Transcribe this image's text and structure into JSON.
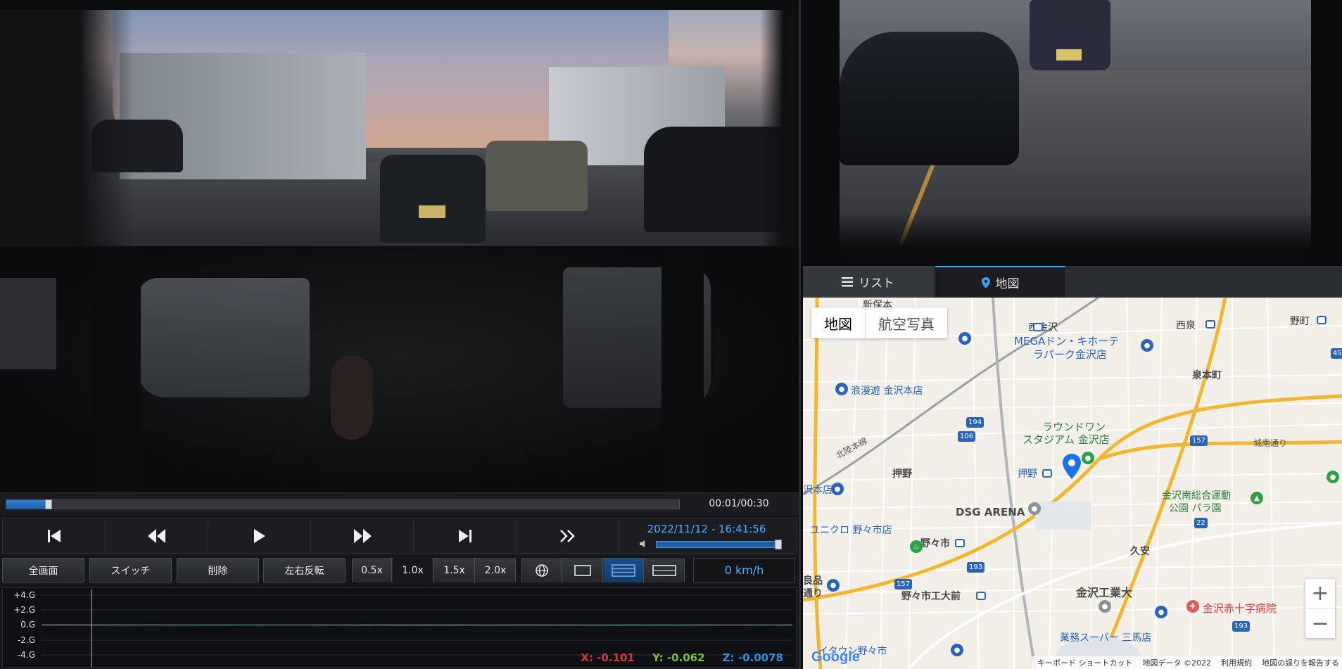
{
  "player": {
    "time_readout": "00:01/00:30",
    "progress": 0.063,
    "datetime": "2022/11/12 - 16:41:56",
    "volume": 1.0,
    "speed_readout": "0 km/h"
  },
  "transport": {
    "buttons": [
      {
        "name": "skip-to-start-icon"
      },
      {
        "name": "rewind-icon"
      },
      {
        "name": "play-icon"
      },
      {
        "name": "fast-forward-icon"
      },
      {
        "name": "skip-to-end-icon"
      },
      {
        "name": "double-chevron-right-icon"
      }
    ]
  },
  "controls": {
    "fullscreen": "全画面",
    "switch": "スイッチ",
    "delete": "削除",
    "mirror": "左右反転",
    "speeds": [
      "0.5x",
      "1.0x",
      "1.5x",
      "2.0x"
    ],
    "active_speed": "1.0x"
  },
  "gsensor": {
    "labels": [
      "+4.G",
      "+2.G",
      "0.G",
      "-2.G",
      "-4.G"
    ],
    "x": "X: -0.101",
    "y": "Y: -0.062",
    "z": "Z: -0.0078",
    "colors": {
      "x": "#d63a3a",
      "y": "#79c23a",
      "z": "#2f8fe8"
    }
  },
  "tabs": {
    "list": "リスト",
    "map": "地図"
  },
  "map": {
    "type_map": "地図",
    "type_aerial": "航空写真",
    "labels": {
      "nishikanazawa": "西金沢",
      "nishiizumi": "西泉",
      "nonoichi_top": "野町",
      "mega1": "MEGAドン・キホーテ",
      "mega2": "ラパーク金沢店",
      "izumihoncho": "泉本町",
      "romanyu": "浪漫遊 金沢本店",
      "hokuriku": "北陸本線",
      "round1a": "ラウンドワン",
      "round1b": "スタジアム 金沢店",
      "jonan": "城南通り",
      "oshino": "押野",
      "oshino_st": "押野",
      "honten": "沢本店",
      "dsg": "DSG ARENA",
      "park1": "金沢南総合運動",
      "park2": "公園 パラ園",
      "uniqlo": "ユニクロ 野々市店",
      "nonoichi": "野々市",
      "hisayasu": "久安",
      "kohgyo": "金沢工業大",
      "nonoichi_kodai": "野々市工大前",
      "ryohin1": "良品",
      "ryohin2": "通り",
      "redcross": "金沢赤十字病院",
      "gyomu": "業務スーパー 三馬店",
      "aeon": "イタウン野々市",
      "shinkai": "新保本"
    },
    "routes": [
      "194",
      "106",
      "157",
      "157",
      "22",
      "193",
      "157",
      "193",
      "45"
    ],
    "google": "Google",
    "attribution": [
      "キーボード ショートカット",
      "地図データ ©2022",
      "利用規約",
      "地図の誤りを報告する"
    ]
  },
  "colors": {
    "accent": "#3f9bf0",
    "pin": "#1a73e8"
  }
}
